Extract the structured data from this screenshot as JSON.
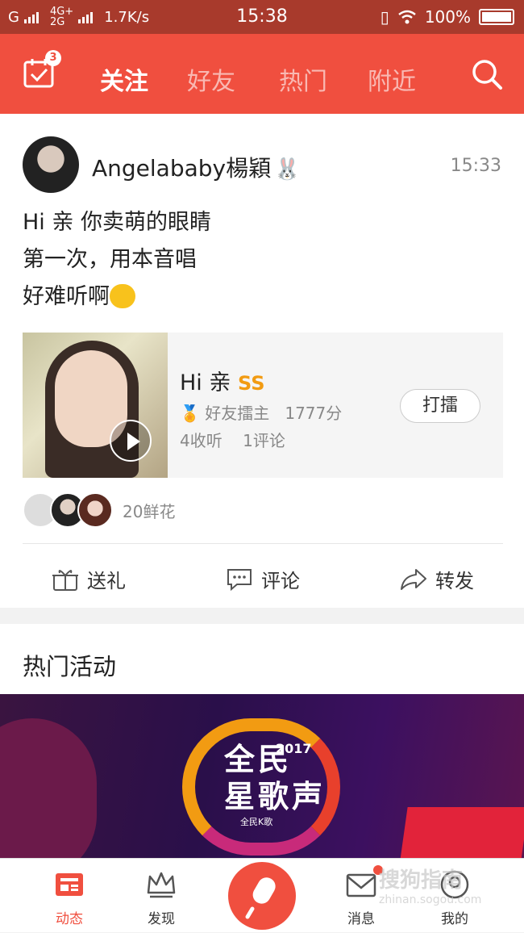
{
  "status_bar": {
    "carrier": "G",
    "network_top": "4G+",
    "network_bottom": "2G",
    "speed": "1.7K/s",
    "time": "15:38",
    "battery": "100%"
  },
  "top_nav": {
    "tasks_badge": "3",
    "tabs": [
      {
        "label": "关注",
        "active": true
      },
      {
        "label": "好友",
        "active": false
      },
      {
        "label": "热门",
        "active": false
      },
      {
        "label": "附近",
        "active": false
      }
    ],
    "accent": "#f04f3f"
  },
  "post": {
    "username": "Angelababy楊穎",
    "time": "15:33",
    "lines": [
      "Hi 亲  你卖萌的眼睛",
      "第一次，用本音唱",
      "好难听啊"
    ],
    "song": {
      "title": "Hi 亲",
      "grade": "SS",
      "role": "好友擂主",
      "score": "1777分",
      "listens": "4收听",
      "comments": "1评论",
      "action": "打擂"
    },
    "flowers": "20鲜花",
    "actions": {
      "gift": "送礼",
      "comment": "评论",
      "share": "转发"
    }
  },
  "hot": {
    "title": "热门活动",
    "banner": {
      "line1": "全民",
      "line2": "星歌声",
      "year": "2017",
      "logo": "全民K歌"
    }
  },
  "bottom_nav": {
    "items": [
      "动态",
      "发现",
      "消息",
      "我的"
    ]
  },
  "watermark": {
    "text": "搜狗指南",
    "sub": "zhinan.sogou.com"
  }
}
